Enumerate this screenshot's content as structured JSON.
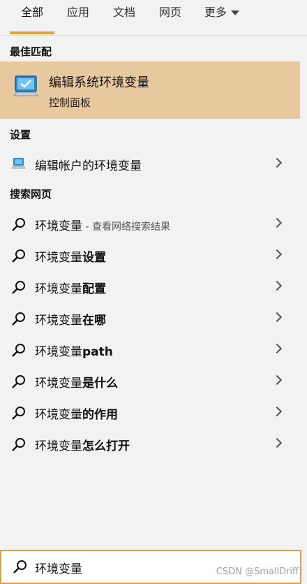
{
  "tabs": [
    {
      "label": "全部"
    },
    {
      "label": "应用"
    },
    {
      "label": "文档"
    },
    {
      "label": "网页"
    },
    {
      "label": "更多"
    }
  ],
  "best_match": {
    "section_title": "最佳匹配",
    "title": "编辑系统环境变量",
    "subtitle": "控制面板"
  },
  "settings": {
    "section_title": "设置",
    "item_label": "编辑帐户的环境变量"
  },
  "web": {
    "section_title": "搜索网页",
    "items": [
      {
        "base": "环境变量",
        "extra": "",
        "hint": " - 查看网络搜索结果"
      },
      {
        "base": "环境变量",
        "extra": "设置",
        "hint": ""
      },
      {
        "base": "环境变量",
        "extra": "配置",
        "hint": ""
      },
      {
        "base": "环境变量",
        "extra": "在哪",
        "hint": ""
      },
      {
        "base": "环境变量",
        "extra": "path",
        "hint": ""
      },
      {
        "base": "环境变量",
        "extra": "是什么",
        "hint": ""
      },
      {
        "base": "环境变量",
        "extra": "的作用",
        "hint": ""
      },
      {
        "base": "环境变量",
        "extra": "怎么打开",
        "hint": ""
      }
    ]
  },
  "search": {
    "value": "环境变量"
  },
  "watermark": "CSDN @SmallDriff",
  "colors": {
    "accent": "#e8a23e",
    "best_match_bg": "#e8c89e",
    "background": "#f2f2f2"
  }
}
